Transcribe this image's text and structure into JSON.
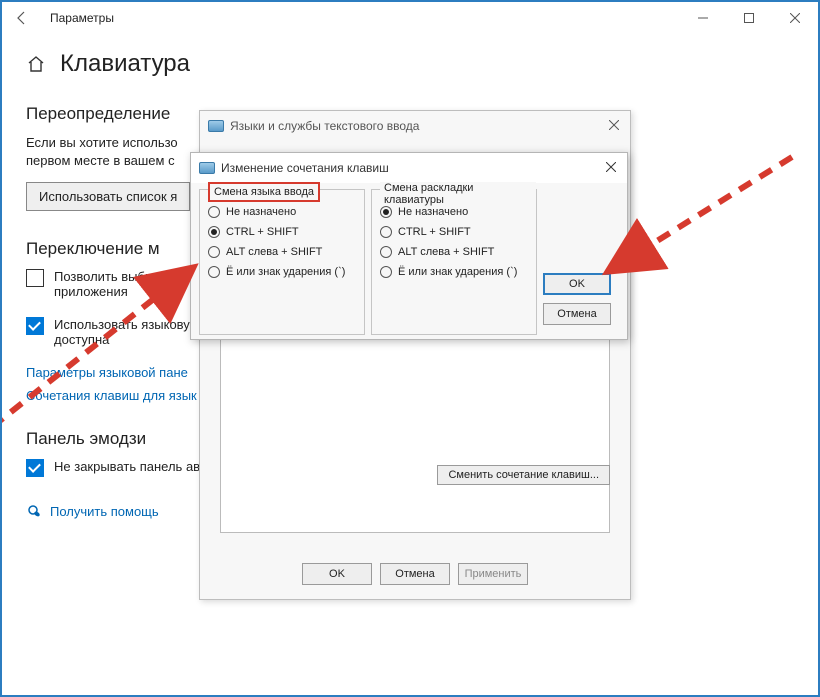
{
  "settings": {
    "window_title": "Параметры",
    "page_title": "Клавиатура",
    "section_override": "Переопределение",
    "body_override_1": "Если вы хотите использо",
    "body_override_2": "первом месте в вашем с",
    "use_list_btn": "Использовать список я",
    "section_switch": "Переключение м",
    "chk_allow_1": "Позволить выбирать м",
    "chk_allow_2": "приложения",
    "chk_uselang_1": "Использовать языкову",
    "chk_uselang_2": "доступна",
    "link_langbar": "Параметры языковой пане",
    "link_hotkeys": "Сочетания клавиш для язык",
    "section_emoji": "Панель эмодзи",
    "chk_emoji": "Не закрывать панель автоматически после ввода эмодзи",
    "link_help": "Получить помощь"
  },
  "dlg1": {
    "title": "Языки и службы текстового ввода",
    "change_btn": "Сменить сочетание клавиш...",
    "ok": "OK",
    "cancel": "Отмена",
    "apply": "Применить"
  },
  "dlg2": {
    "title": "Изменение сочетания клавиш",
    "left_legend": "Смена языка ввода",
    "right_legend": "Смена раскладки клавиатуры",
    "opt_none": "Не назначено",
    "opt_ctrl": "CTRL + SHIFT",
    "opt_alt": "ALT слева + SHIFT",
    "opt_accent": "Ё или знак ударения (`)",
    "ok": "OK",
    "cancel": "Отмена"
  }
}
